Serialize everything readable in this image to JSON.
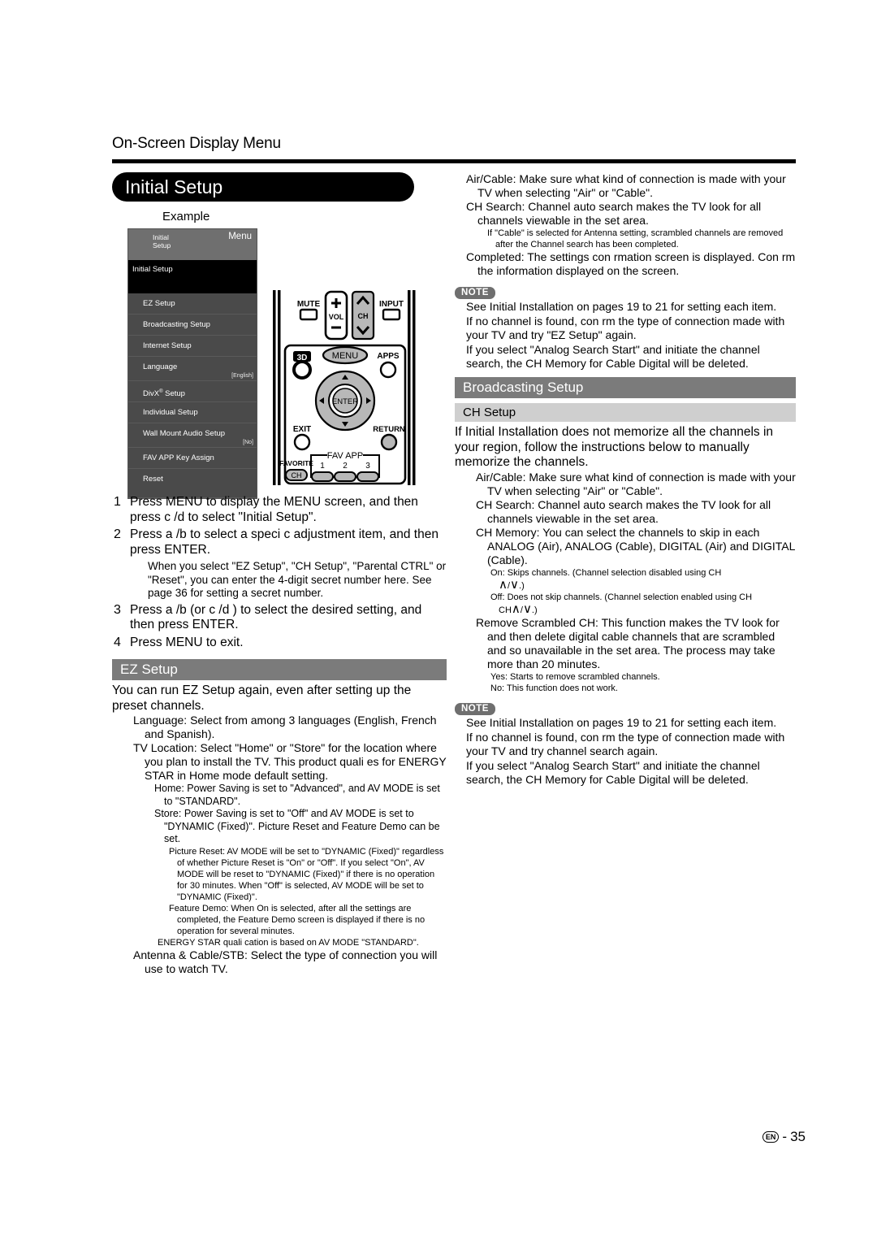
{
  "header": {
    "running_head": "On-Screen Display Menu",
    "page_title": "Initial Setup"
  },
  "example": {
    "label": "Example",
    "tv_menu": {
      "breadcrumb": "Initial\nSetup",
      "menu_word": "Menu",
      "selected_item": "Initial Setup",
      "items": [
        {
          "label": "EZ Setup",
          "value": ""
        },
        {
          "label": "Broadcasting Setup",
          "value": ""
        },
        {
          "label": "Internet Setup",
          "value": ""
        },
        {
          "label": "Language",
          "value": "[English]"
        },
        {
          "label": "DivX Setup",
          "value": ""
        },
        {
          "label": "Individual Setup",
          "value": ""
        },
        {
          "label": "Wall Mount Audio Setup",
          "value": "[No]"
        },
        {
          "label": "FAV APP Key Assign",
          "value": ""
        },
        {
          "label": "Reset",
          "value": ""
        }
      ]
    },
    "remote": {
      "mute": "MUTE",
      "vol": "VOL",
      "ch": "CH",
      "input": "INPUT",
      "three_d": "3D",
      "menu": "MENU",
      "apps": "APPS",
      "enter": "ENTER",
      "exit": "EXIT",
      "return": "RETURN",
      "favorite": "FAVORITE",
      "favorite_ch": "CH",
      "fav_app": "FAV APP",
      "fav_app_1": "1",
      "fav_app_2": "2",
      "fav_app_3": "3"
    }
  },
  "steps": [
    {
      "num": "1",
      "text": "Press MENU to display the MENU screen, and then press c /d to select \"Initial Setup\".",
      "note": ""
    },
    {
      "num": "2",
      "text": "Press a /b to select a speci c adjustment item, and then press ENTER.",
      "note": "When you select \"EZ Setup\", \"CH Setup\", \"Parental CTRL\" or \"Reset\", you can enter the 4-digit secret number here. See page 36 for setting a secret number."
    },
    {
      "num": "3",
      "text": "Press a /b (or c /d ) to select the desired setting, and then press ENTER.",
      "note": ""
    },
    {
      "num": "4",
      "text": "Press MENU to exit.",
      "note": ""
    }
  ],
  "ez_setup": {
    "bar": "EZ Setup",
    "intro": "You can run EZ Setup again, even after setting up the preset channels.",
    "language": "Language: Select from among 3 languages (English, French and Spanish).",
    "tv_location": "TV Location: Select \"Home\" or \"Store\" for the location where you plan to install the TV. This product quali es for ENERGY STAR in Home mode default setting.",
    "home": "Home: Power Saving is set to \"Advanced\", and AV MODE is set to \"STANDARD\".",
    "store": "Store: Power Saving is set to \"Off\" and AV MODE is set to \"DYNAMIC (Fixed)\". Picture Reset and Feature Demo can be set.",
    "picture_reset": "Picture Reset: AV MODE will be set to \"DYNAMIC (Fixed)\" regardless of whether Picture Reset is \"On\" or \"Off\". If you select \"On\", AV MODE will be reset to \"DYNAMIC (Fixed)\" if there is no operation for 30 minutes. When \"Off\" is selected, AV MODE will be set to \"DYNAMIC (Fixed)\".",
    "feature_demo": "Feature Demo: When On is selected, after all the settings are completed, the Feature Demo screen is displayed if there is no operation for several minutes.",
    "energy_star": "ENERGY STAR quali cation is based on AV MODE \"STANDARD\".",
    "antenna": "Antenna & Cable/STB: Select the type of connection you will use to watch TV."
  },
  "right_top": {
    "air_cable": "Air/Cable: Make sure what kind of connection is made with your TV when selecting \"Air\" or \"Cable\".",
    "ch_search": "CH Search: Channel auto search makes the TV look for all channels viewable in the set area.",
    "ch_search_sub": "If \"Cable\" is selected for Antenna setting, scrambled channels are removed after the Channel search has been completed.",
    "completed": "Completed: The settings con rmation screen is displayed. Con rm the information displayed on the screen."
  },
  "note_1": {
    "badge": "NOTE",
    "lines": [
      "See Initial Installation on pages 19 to 21 for setting each item.",
      "If no channel is found, con rm the type of connection made with your TV and try \"EZ Setup\" again.",
      "If you select \"Analog Search Start\" and initiate the channel search, the CH Memory for Cable Digital will be deleted."
    ]
  },
  "broadcasting": {
    "bar": "Broadcasting Setup",
    "sub_bar": "CH Setup",
    "intro": "If Initial Installation does not memorize all the channels in your region, follow the instructions below to manually memorize the channels.",
    "air_cable": "Air/Cable: Make sure what kind of connection is made with your TV when selecting \"Air\" or \"Cable\".",
    "ch_search": "CH Search: Channel auto search makes the TV look for all channels viewable in the set area.",
    "ch_memory": "CH Memory: You can select the channels to skip in each ANALOG (Air), ANALOG (Cable), DIGITAL (Air) and DIGITAL (Cable).",
    "on_line": "On: Skips channels. (Channel selection disabled using CH",
    "on_line_tail": "/",
    "on_line_end": ".)",
    "off_line": "Off: Does not skip channels. (Channel selection enabled using CH",
    "off_line_end": ".)",
    "remove_scrambled": "Remove Scrambled CH: This function makes the TV look for and then delete digital cable channels that are scrambled and so unavailable in the set area. The process may take more than 20 minutes.",
    "yes": "Yes: Starts to remove scrambled channels.",
    "no": "No: This function does not work."
  },
  "note_2": {
    "badge": "NOTE",
    "lines": [
      "See Initial Installation on pages 19 to 21 for setting each item.",
      "If no channel is found, con rm the type of connection made with your TV and try channel search again.",
      "If you select \"Analog Search Start\" and initiate the channel search, the CH Memory for Cable Digital will be deleted."
    ]
  },
  "footer": {
    "lang_mark": "EN",
    "separator": "-",
    "page_number": "35"
  }
}
